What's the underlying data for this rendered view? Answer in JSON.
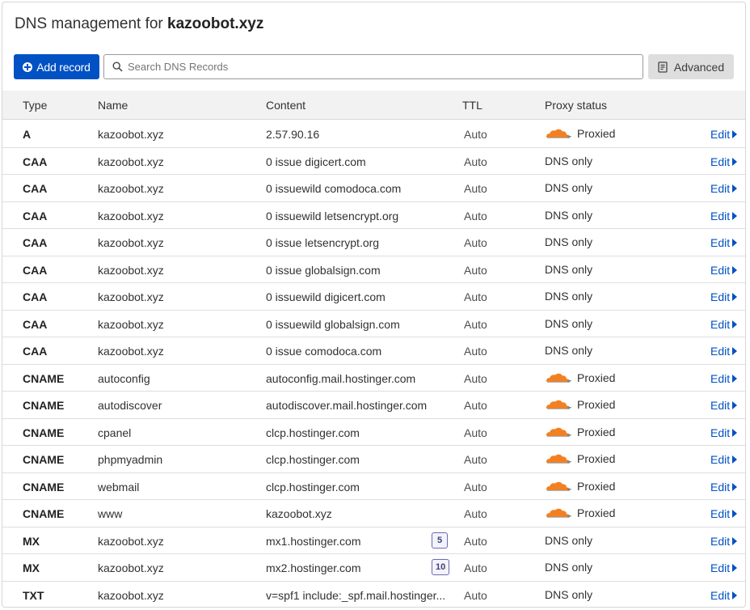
{
  "header": {
    "title_prefix": "DNS management for",
    "domain": "kazoobot.xyz"
  },
  "toolbar": {
    "add_label": "Add record",
    "search_placeholder": "Search DNS Records",
    "advanced_label": "Advanced"
  },
  "columns": {
    "type": "Type",
    "name": "Name",
    "content": "Content",
    "ttl": "TTL",
    "proxy": "Proxy status"
  },
  "edit_label": "Edit",
  "colors": {
    "accent": "#0051c3",
    "cloud": "#f38020"
  },
  "records": [
    {
      "type": "A",
      "name": "kazoobot.xyz",
      "content": "2.57.90.16",
      "ttl": "Auto",
      "proxy": "Proxied",
      "priority": ""
    },
    {
      "type": "CAA",
      "name": "kazoobot.xyz",
      "content": "0 issue digicert.com",
      "ttl": "Auto",
      "proxy": "DNS only",
      "priority": ""
    },
    {
      "type": "CAA",
      "name": "kazoobot.xyz",
      "content": "0 issuewild comodoca.com",
      "ttl": "Auto",
      "proxy": "DNS only",
      "priority": ""
    },
    {
      "type": "CAA",
      "name": "kazoobot.xyz",
      "content": "0 issuewild letsencrypt.org",
      "ttl": "Auto",
      "proxy": "DNS only",
      "priority": ""
    },
    {
      "type": "CAA",
      "name": "kazoobot.xyz",
      "content": "0 issue letsencrypt.org",
      "ttl": "Auto",
      "proxy": "DNS only",
      "priority": ""
    },
    {
      "type": "CAA",
      "name": "kazoobot.xyz",
      "content": "0 issue globalsign.com",
      "ttl": "Auto",
      "proxy": "DNS only",
      "priority": ""
    },
    {
      "type": "CAA",
      "name": "kazoobot.xyz",
      "content": "0 issuewild digicert.com",
      "ttl": "Auto",
      "proxy": "DNS only",
      "priority": ""
    },
    {
      "type": "CAA",
      "name": "kazoobot.xyz",
      "content": "0 issuewild globalsign.com",
      "ttl": "Auto",
      "proxy": "DNS only",
      "priority": ""
    },
    {
      "type": "CAA",
      "name": "kazoobot.xyz",
      "content": "0 issue comodoca.com",
      "ttl": "Auto",
      "proxy": "DNS only",
      "priority": ""
    },
    {
      "type": "CNAME",
      "name": "autoconfig",
      "content": "autoconfig.mail.hostinger.com",
      "ttl": "Auto",
      "proxy": "Proxied",
      "priority": ""
    },
    {
      "type": "CNAME",
      "name": "autodiscover",
      "content": "autodiscover.mail.hostinger.com",
      "ttl": "Auto",
      "proxy": "Proxied",
      "priority": ""
    },
    {
      "type": "CNAME",
      "name": "cpanel",
      "content": "clcp.hostinger.com",
      "ttl": "Auto",
      "proxy": "Proxied",
      "priority": ""
    },
    {
      "type": "CNAME",
      "name": "phpmyadmin",
      "content": "clcp.hostinger.com",
      "ttl": "Auto",
      "proxy": "Proxied",
      "priority": ""
    },
    {
      "type": "CNAME",
      "name": "webmail",
      "content": "clcp.hostinger.com",
      "ttl": "Auto",
      "proxy": "Proxied",
      "priority": ""
    },
    {
      "type": "CNAME",
      "name": "www",
      "content": "kazoobot.xyz",
      "ttl": "Auto",
      "proxy": "Proxied",
      "priority": ""
    },
    {
      "type": "MX",
      "name": "kazoobot.xyz",
      "content": "mx1.hostinger.com",
      "ttl": "Auto",
      "proxy": "DNS only",
      "priority": "5"
    },
    {
      "type": "MX",
      "name": "kazoobot.xyz",
      "content": "mx2.hostinger.com",
      "ttl": "Auto",
      "proxy": "DNS only",
      "priority": "10"
    },
    {
      "type": "TXT",
      "name": "kazoobot.xyz",
      "content": "v=spf1 include:_spf.mail.hostinger...",
      "ttl": "Auto",
      "proxy": "DNS only",
      "priority": ""
    }
  ]
}
